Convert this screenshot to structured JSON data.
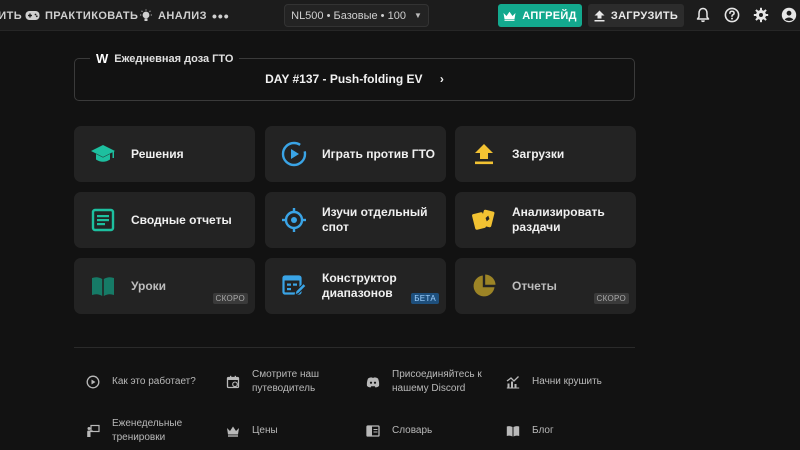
{
  "topbar": {
    "nav_truncated": "ИТЬ",
    "nav_practice": "ПРАКТИКОВАТЬ",
    "nav_analysis": "АНАЛИЗ",
    "nav_more": "•••",
    "selector": "NL500 • Базовые • 100",
    "upgrade_label": "АПГРЕЙД",
    "upload_label": "ЗАГРУЗИТЬ"
  },
  "daily": {
    "logo": "W",
    "label": "Ежедневная доза ГТО",
    "link": "DAY #137 - Push-folding EV",
    "chevron": "›"
  },
  "tiles": [
    {
      "label": "Решения",
      "icon": "graduation-cap-icon",
      "color": "#1dbf9f"
    },
    {
      "label": "Играть против ГТО",
      "icon": "play-circle-icon",
      "color": "#3aa4e6"
    },
    {
      "label": "Загрузки",
      "icon": "upload-icon",
      "color": "#f2c232"
    },
    {
      "label": "Сводные отчеты",
      "icon": "report-icon",
      "color": "#1dbf9f"
    },
    {
      "label": "Изучи отдельный спот",
      "icon": "crosshair-icon",
      "color": "#3aa4e6"
    },
    {
      "label": "Анализировать раздачи",
      "icon": "cards-icon",
      "color": "#f2c232"
    },
    {
      "label": "Уроки",
      "icon": "book-icon",
      "color": "#167a66",
      "badge": "СКОРО"
    },
    {
      "label": "Конструктор диапазонов",
      "icon": "range-builder-icon",
      "color": "#3aa4e6",
      "badge": "БЕТА"
    },
    {
      "label": "Отчеты",
      "icon": "pie-chart-icon",
      "color": "#9c8426",
      "badge": "СКОРО"
    }
  ],
  "links": [
    {
      "label": "Как это работает?",
      "icon": "play-circle-icon"
    },
    {
      "label": "Смотрите наш путеводитель",
      "icon": "calendar-icon"
    },
    {
      "label": "Присоединяйтесь к нашему Discord",
      "icon": "discord-icon"
    },
    {
      "label": "Начни крушить",
      "icon": "growth-chart-icon"
    },
    {
      "label": "Еженедельные тренировки",
      "icon": "presentation-icon"
    },
    {
      "label": "Цены",
      "icon": "crown-icon"
    },
    {
      "label": "Словарь",
      "icon": "dictionary-icon"
    },
    {
      "label": "Блог",
      "icon": "book-icon"
    }
  ]
}
